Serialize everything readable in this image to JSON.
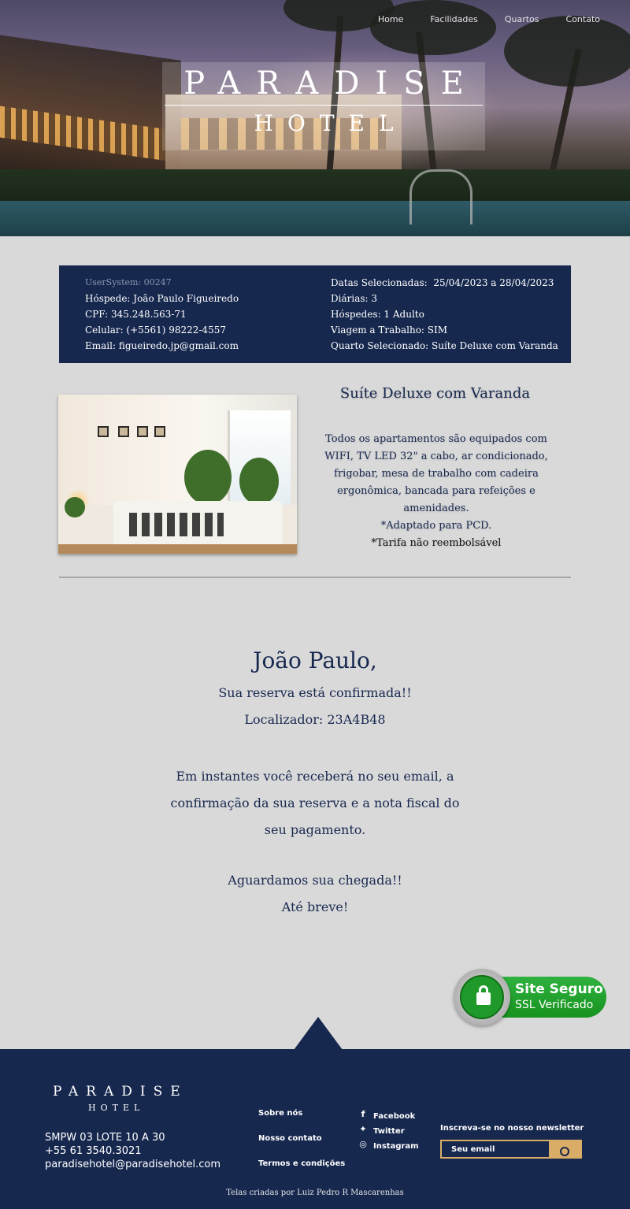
{
  "nav": {
    "items": [
      "Home",
      "Facilidades",
      "Quartos",
      "Contato"
    ]
  },
  "hero": {
    "logo_line1": "PARADISE",
    "logo_line2": "HOTEL"
  },
  "booking": {
    "left": {
      "user_system": "UserSystem: 00247",
      "guest": "Hóspede: João Paulo Figueiredo",
      "cpf": "CPF: 345.248.563-71",
      "phone": "Celular: (+5561) 98222-4557",
      "email": "Email: figueiredo.jp@gmail.com"
    },
    "right": {
      "dates": "Datas Selecionadas:  25/04/2023 a 28/04/2023",
      "nights": "Diárias: 3",
      "guests": "Hóspedes: 1 Adulto",
      "work_trip": "Viagem a Trabalho: SIM",
      "room": "Quarto Selecionado: Suíte Deluxe com Varanda"
    }
  },
  "room": {
    "title": "Suíte Deluxe com Varanda",
    "description": "Todos os apartamentos são equipados com WIFI, TV LED 32\" a cabo, ar condicionado, frigobar, mesa de trabalho com cadeira ergonômica, bancada para refeições e amenidades.",
    "pcd": "*Adaptado para PCD.",
    "non_refundable": "*Tarifa não reembolsável"
  },
  "confirmation": {
    "greeting": "João Paulo,",
    "confirmed": "Sua reserva está confirmada!!",
    "locator": "Localizador: 23A4B48",
    "message": "Em instantes você receberá no seu email, a confirmação da sua reserva e a nota fiscal do seu pagamento.",
    "await": "Aguardamos sua chegada!!",
    "bye": "Até breve!"
  },
  "ssl_badge": {
    "title": "Site Seguro",
    "subtitle": "SSL Verificado"
  },
  "footer": {
    "logo_line1": "PARADISE",
    "logo_line2": "HOTEL",
    "address": "SMPW 03 LOTE 10 A 30",
    "phone": "+55 61 3540.3021",
    "email": "paradisehotel@paradisehotel.com",
    "links": [
      "Sobre nós",
      "Nosso contato",
      "Termos e condições"
    ],
    "social": [
      {
        "label": "Facebook",
        "icon": "facebook-icon"
      },
      {
        "label": "Twitter",
        "icon": "twitter-icon"
      },
      {
        "label": "Instagram",
        "icon": "instagram-icon"
      }
    ],
    "newsletter_label": "Inscreva-se no nosso newsletter",
    "newsletter_placeholder": "Seu email",
    "credit": "Telas criadas por Luiz Pedro R Mascarenhas"
  },
  "colors": {
    "navy": "#17284f",
    "gold": "#d9ad68",
    "background": "#d9d9d9",
    "ssl_green": "#1f9a2a"
  }
}
